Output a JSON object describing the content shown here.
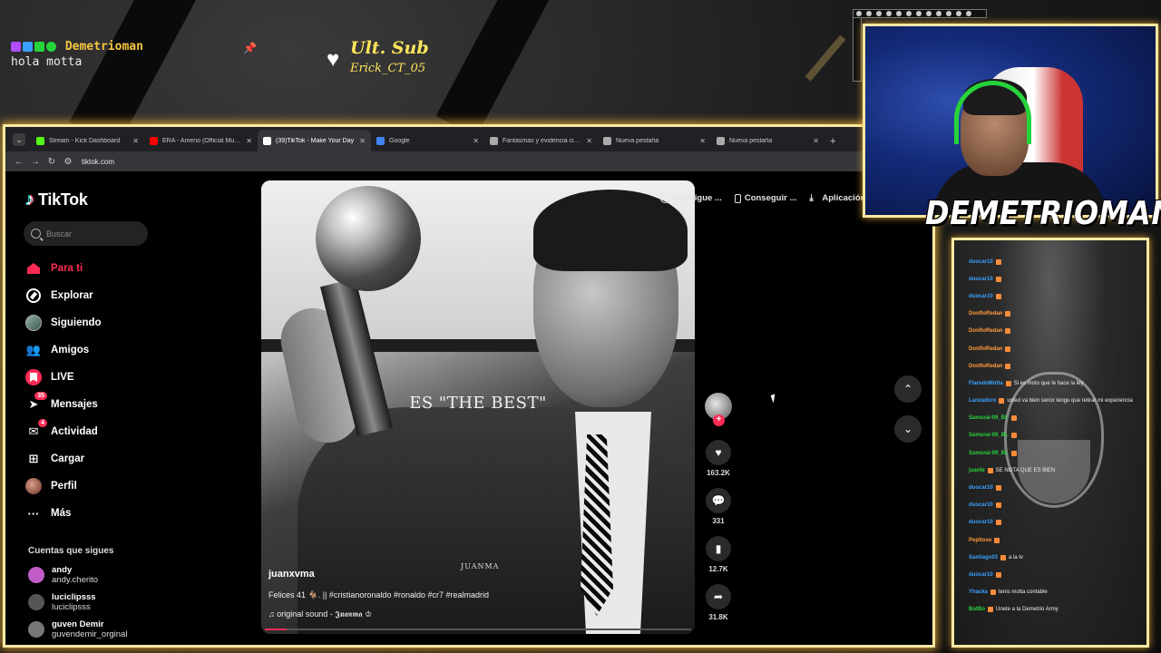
{
  "overlay": {
    "chat_alert": {
      "user": "Demetrioman",
      "message": "hola motta",
      "badge_colors": [
        "#b04dff",
        "#3aa0ff",
        "#27d33b",
        "#27d33b"
      ]
    },
    "last_sub": {
      "title": "Ult. Sub",
      "name": "Erick_CT_05"
    },
    "streamer_name": "DEMETRIOMAN"
  },
  "browser": {
    "tabs": [
      {
        "label": "Stream - Kick Dashboard",
        "favicon_color": "#53fc18",
        "active": false
      },
      {
        "label": "ERA - Ameno (Official Music Vi...",
        "favicon_color": "#ff0000",
        "active": false
      },
      {
        "label": "(39)TikTok - Make Your Day",
        "favicon_color": "#ffffff",
        "active": true
      },
      {
        "label": "Google",
        "favicon_color": "#4285f4",
        "active": false
      },
      {
        "label": "Fantasmas y evidencia científic...",
        "favicon_color": "#aaaaaa",
        "active": false
      },
      {
        "label": "Nueva pestaña",
        "favicon_color": "#aaaaaa",
        "active": false
      },
      {
        "label": "Nueva pestaña",
        "favicon_color": "#aaaaaa",
        "active": false
      }
    ],
    "url": "tiktok.com"
  },
  "tiktok": {
    "brand": "TikTok",
    "search_placeholder": "Buscar",
    "menu": [
      {
        "label": "Para ti",
        "icon": "home-icon",
        "badge": ""
      },
      {
        "label": "Explorar",
        "icon": "compass-icon",
        "badge": ""
      },
      {
        "label": "Siguiendo",
        "icon": "avatar-icon",
        "badge": ""
      },
      {
        "label": "Amigos",
        "icon": "friends-icon",
        "badge": ""
      },
      {
        "label": "LIVE",
        "icon": "live-icon",
        "badge": ""
      },
      {
        "label": "Mensajes",
        "icon": "send-icon",
        "badge": "35"
      },
      {
        "label": "Actividad",
        "icon": "inbox-icon",
        "badge": "4"
      },
      {
        "label": "Cargar",
        "icon": "plus-icon",
        "badge": ""
      },
      {
        "label": "Perfil",
        "icon": "profile-icon",
        "badge": ""
      },
      {
        "label": "Más",
        "icon": "more-icon",
        "badge": ""
      }
    ],
    "following_title": "Cuentas que sigues",
    "following": [
      {
        "name": "andy",
        "handle": "andy.cherito",
        "color": "#c25dc7"
      },
      {
        "name": "luciclipsss",
        "handle": "luciclipsss",
        "color": "#555555"
      },
      {
        "name": "guven Demir",
        "handle": "guvendemir_orginal",
        "color": "#777777"
      }
    ],
    "top_actions": [
      "Consigue ...",
      "Conseguir ...",
      "Aplicación"
    ],
    "video": {
      "caption": "ES \"THE BEST\"",
      "watermark": "JUANMA",
      "author": "juanxvma",
      "description": "Felices 41 🐐. || #cristianoronaldo #ronaldo #cr7 #realmadrid",
      "sound": "♫ original sound - 𝕵𝖚𝖆𝖓𝖒𝖆 ♔",
      "progress": 0.05
    },
    "stats": {
      "likes": "163.2K",
      "comments": "331",
      "saves": "12.7K",
      "shares": "31.8K"
    }
  },
  "chat_panel": {
    "lines": [
      {
        "user": "duocar10",
        "msg": "",
        "color": "#3aa0ff"
      },
      {
        "user": "duocar10",
        "msg": "",
        "color": "#3aa0ff"
      },
      {
        "user": "duocar10",
        "msg": "",
        "color": "#3aa0ff"
      },
      {
        "user": "DonfloRedan",
        "msg": "",
        "color": "#ff9a3b"
      },
      {
        "user": "DonfloRedan",
        "msg": "",
        "color": "#ff9a3b"
      },
      {
        "user": "DonfloRedan",
        "msg": "",
        "color": "#ff9a3b"
      },
      {
        "user": "DonfloRedan",
        "msg": "",
        "color": "#ff9a3b"
      },
      {
        "user": "FlaredoMotta",
        "msg": "Si es moto que le hace la ley",
        "color": "#3aa0ff"
      },
      {
        "user": "Lanzadoro",
        "msg": "usted va bien senor tengo que retirar mi experiencia",
        "color": "#3aa0ff"
      },
      {
        "user": "Samurai-09_BL",
        "msg": "",
        "color": "#27d33b"
      },
      {
        "user": "Samurai-09_BL",
        "msg": "",
        "color": "#27d33b"
      },
      {
        "user": "Samurai-09_BL",
        "msg": "",
        "color": "#27d33b"
      },
      {
        "user": "juanfe",
        "msg": "SE NOTA QUE ES BIEN",
        "color": "#27d33b"
      },
      {
        "user": "duocar10",
        "msg": "",
        "color": "#3aa0ff"
      },
      {
        "user": "duocar10",
        "msg": "",
        "color": "#3aa0ff"
      },
      {
        "user": "duocar10",
        "msg": "",
        "color": "#3aa0ff"
      },
      {
        "user": "Pepitoso",
        "msg": "",
        "color": "#ff9a3b"
      },
      {
        "user": "Santiago03",
        "msg": "a la tv",
        "color": "#3aa0ff"
      },
      {
        "user": "duocar10",
        "msg": "",
        "color": "#3aa0ff"
      },
      {
        "user": "Yhacka",
        "msg": "tenis motta contable",
        "color": "#3aa0ff"
      },
      {
        "user": "BotBo",
        "msg": "Unete a la Demetrio Army",
        "color": "#27d33b"
      }
    ]
  }
}
